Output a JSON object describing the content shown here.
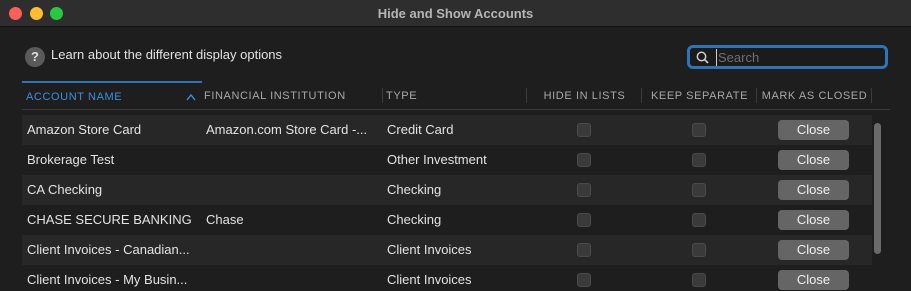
{
  "window": {
    "title": "Hide and Show Accounts"
  },
  "help": {
    "icon": "?",
    "text": "Learn about the different display options"
  },
  "search": {
    "placeholder": "Search",
    "value": ""
  },
  "table": {
    "columns": {
      "account_name": "ACCOUNT NAME",
      "financial_institution": "FINANCIAL INSTITUTION",
      "type": "TYPE",
      "hide_in_lists": "HIDE IN LISTS",
      "keep_separate": "KEEP SEPARATE",
      "mark_as_closed": "MARK AS CLOSED"
    },
    "sort_icon": "^",
    "rows": [
      {
        "name": "Amazon Store Card",
        "institution": "Amazon.com Store Card -...",
        "type": "Credit Card",
        "hide": false,
        "keep": false,
        "action": "Close"
      },
      {
        "name": "Brokerage Test",
        "institution": "",
        "type": "Other Investment",
        "hide": false,
        "keep": false,
        "action": "Close"
      },
      {
        "name": "CA Checking",
        "institution": "",
        "type": "Checking",
        "hide": false,
        "keep": false,
        "action": "Close"
      },
      {
        "name": "CHASE SECURE BANKING",
        "institution": "Chase",
        "type": "Checking",
        "hide": false,
        "keep": false,
        "action": "Close"
      },
      {
        "name": "Client Invoices - Canadian...",
        "institution": "",
        "type": "Client Invoices",
        "hide": false,
        "keep": false,
        "action": "Close"
      },
      {
        "name": "Client Invoices - My Busin...",
        "institution": "",
        "type": "Client Invoices",
        "hide": false,
        "keep": false,
        "action": "Close"
      }
    ]
  },
  "colors": {
    "accent": "#2f75b6",
    "close_button": "#656565",
    "background": "#1e1e1e"
  }
}
